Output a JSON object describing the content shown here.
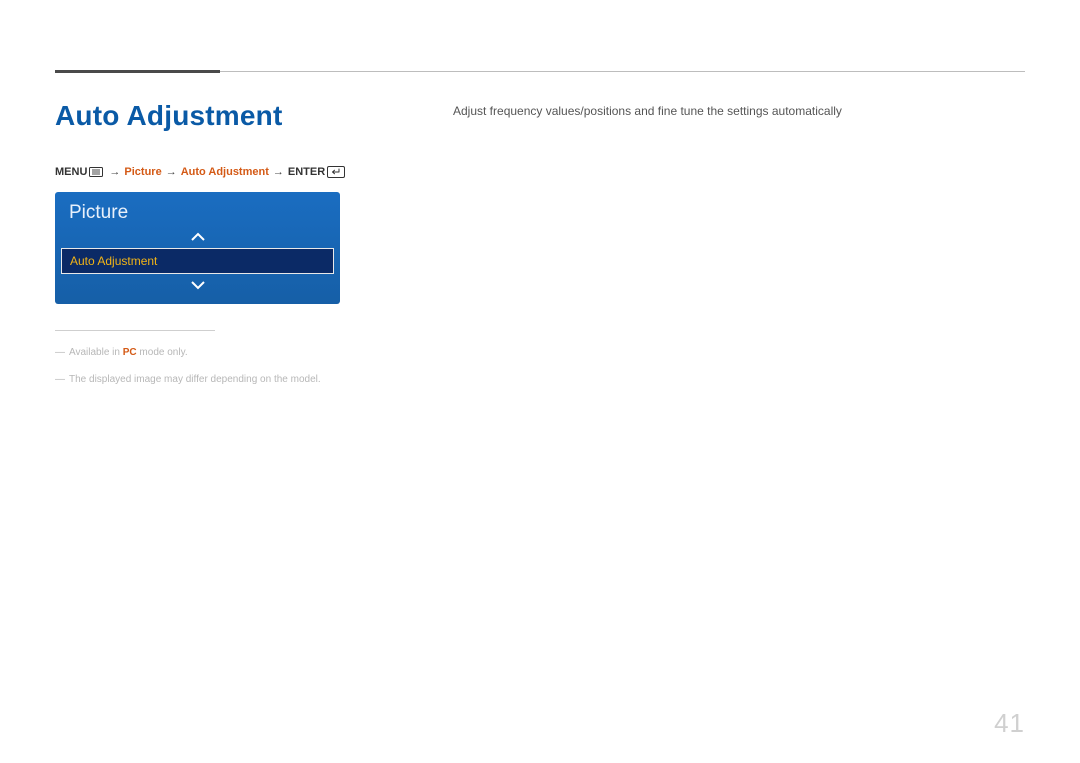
{
  "page": {
    "title": "Auto Adjustment",
    "number": "41",
    "description": "Adjust frequency values/positions and fine tune the settings automatically"
  },
  "breadcrumb": {
    "menu": "MENU",
    "arrow": "→",
    "seg1": "Picture",
    "seg2": "Auto Adjustment",
    "enter": "ENTER"
  },
  "osd": {
    "header": "Picture",
    "item": "Auto Adjustment"
  },
  "notes": {
    "n1_pre": "Available in ",
    "n1_hl": "PC",
    "n1_post": " mode only.",
    "n2": "The displayed image may differ depending on the model."
  }
}
